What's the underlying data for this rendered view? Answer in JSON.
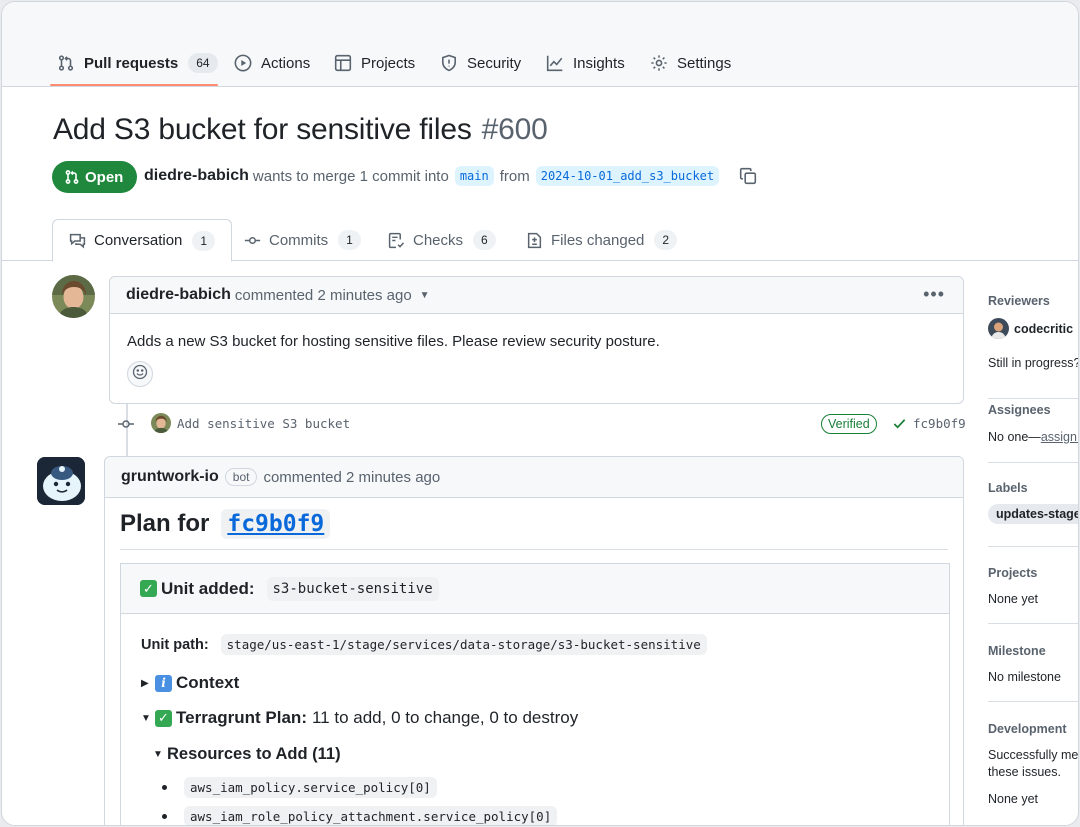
{
  "nav": {
    "items": [
      {
        "label": "Pull requests",
        "count": "64"
      },
      {
        "label": "Actions"
      },
      {
        "label": "Projects"
      },
      {
        "label": "Security"
      },
      {
        "label": "Insights"
      },
      {
        "label": "Settings"
      }
    ]
  },
  "pr": {
    "title": "Add S3 bucket for sensitive files",
    "number": "#600",
    "state": "Open",
    "author": "diedre-babich",
    "merge_text": "wants to merge 1 commit into",
    "base_branch": "main",
    "from_text": "from",
    "head_branch": "2024-10-01_add_s3_bucket"
  },
  "tabs": [
    {
      "label": "Conversation",
      "count": "1"
    },
    {
      "label": "Commits",
      "count": "1"
    },
    {
      "label": "Checks",
      "count": "6"
    },
    {
      "label": "Files changed",
      "count": "2"
    }
  ],
  "comment1": {
    "author": "diedre-babich",
    "meta": "commented 2 minutes ago",
    "body": "Adds a new S3 bucket for hosting sensitive files. Please review security posture."
  },
  "commit": {
    "message": "Add sensitive S3 bucket",
    "verified": "Verified",
    "sha": "fc9b0f9"
  },
  "comment2": {
    "author": "gruntwork-io",
    "bot_label": "bot",
    "meta": "commented 2 minutes ago",
    "plan_title": "Plan for",
    "plan_sha": "fc9b0f9",
    "unit_added_label": "Unit added:",
    "unit_name": "s3-bucket-sensitive",
    "unit_path_label": "Unit path:",
    "unit_path": "stage/us-east-1/stage/services/data-storage/s3-bucket-sensitive",
    "context_label": "Context",
    "plan_label": "Terragrunt Plan:",
    "plan_summary": "11 to add, 0 to change, 0 to destroy",
    "resources_label": "Resources to Add (11)",
    "resources": [
      "aws_iam_policy.service_policy[0]",
      "aws_iam_role_policy_attachment.service_policy[0]"
    ]
  },
  "sidebar": {
    "reviewers_heading": "Reviewers",
    "reviewer": "codecritic",
    "reviewer_status": "Still in progress?",
    "assignees_heading": "Assignees",
    "assignees_value": "No one—",
    "assign_link": "assign yourself",
    "labels_heading": "Labels",
    "label": "updates-stage",
    "projects_heading": "Projects",
    "projects_value": "None yet",
    "milestone_heading": "Milestone",
    "milestone_value": "No milestone",
    "development_heading": "Development",
    "development_line1": "Successfully merging this pull request may close",
    "development_line2": "these issues.",
    "development_value": "None yet"
  },
  "colors": {
    "open_green": "#1f883d",
    "link_blue": "#0969da",
    "nav_underline": "#fd8c73"
  }
}
